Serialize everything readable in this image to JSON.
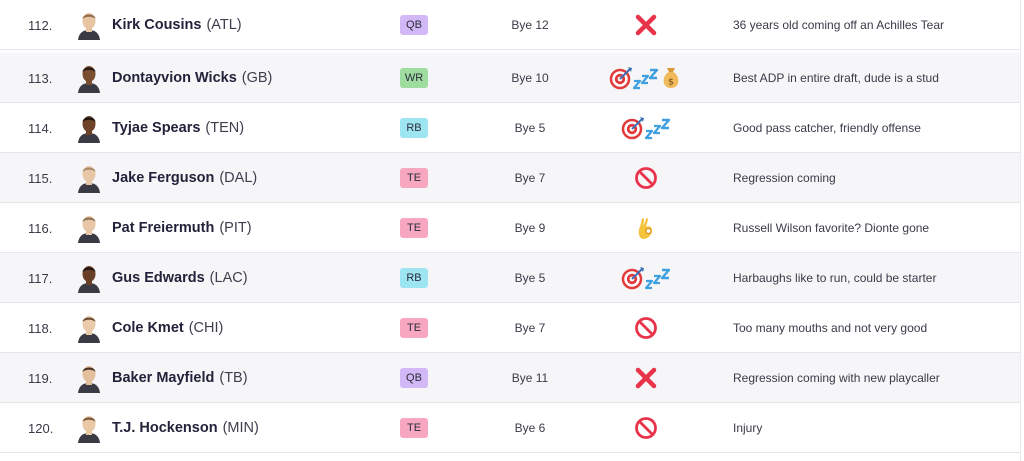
{
  "rows": [
    {
      "rank": "112.",
      "name": "Kirk Cousins",
      "team": "(ATL)",
      "position": "QB",
      "bye": "Bye 12",
      "icons": [
        "cross-icon"
      ],
      "note": "36 years old coming off an Achilles Tear",
      "skin": "#e7c4a2",
      "hair": "#8a6a4a"
    },
    {
      "rank": "113.",
      "name": "Dontayvion Wicks",
      "team": "(GB)",
      "position": "WR",
      "bye": "Bye 10",
      "icons": [
        "target-icon",
        "sleeper-icon",
        "money-bag-icon"
      ],
      "note": "Best ADP in entire draft, dude is a stud",
      "skin": "#7a4e30",
      "hair": "#1e1410"
    },
    {
      "rank": "114.",
      "name": "Tyjae Spears",
      "team": "(TEN)",
      "position": "RB",
      "bye": "Bye 5",
      "icons": [
        "target-icon",
        "sleeper-icon"
      ],
      "note": "Good pass catcher, friendly offense",
      "skin": "#6d4229",
      "hair": "#1a1210"
    },
    {
      "rank": "115.",
      "name": "Jake Ferguson",
      "team": "(DAL)",
      "position": "TE",
      "bye": "Bye 7",
      "icons": [
        "prohibited-icon"
      ],
      "note": "Regression coming",
      "skin": "#e8c7a8",
      "hair": "#a88a66"
    },
    {
      "rank": "116.",
      "name": "Pat Freiermuth",
      "team": "(PIT)",
      "position": "TE",
      "bye": "Bye 9",
      "icons": [
        "ok-hand-icon"
      ],
      "note": "Russell Wilson favorite? Dionte gone",
      "skin": "#e8c6a6",
      "hair": "#8a6f52"
    },
    {
      "rank": "117.",
      "name": "Gus Edwards",
      "team": "(LAC)",
      "position": "RB",
      "bye": "Bye 5",
      "icons": [
        "target-icon",
        "sleeper-icon"
      ],
      "note": "Harbaughs like to run, could be starter",
      "skin": "#6a3f27",
      "hair": "#1c130e"
    },
    {
      "rank": "118.",
      "name": "Cole Kmet",
      "team": "(CHI)",
      "position": "TE",
      "bye": "Bye 7",
      "icons": [
        "prohibited-icon"
      ],
      "note": "Too many mouths and not very good",
      "skin": "#ebcaaa",
      "hair": "#6b4d35"
    },
    {
      "rank": "119.",
      "name": "Baker Mayfield",
      "team": "(TB)",
      "position": "QB",
      "bye": "Bye 11",
      "icons": [
        "cross-icon"
      ],
      "note": "Regression coming with new playcaller",
      "skin": "#e4bf9c",
      "hair": "#4a3324"
    },
    {
      "rank": "120.",
      "name": "T.J. Hockenson",
      "team": "(MIN)",
      "position": "TE",
      "bye": "Bye 6",
      "icons": [
        "prohibited-icon"
      ],
      "note": "Injury",
      "skin": "#e9c8a6",
      "hair": "#7a5638"
    }
  ]
}
